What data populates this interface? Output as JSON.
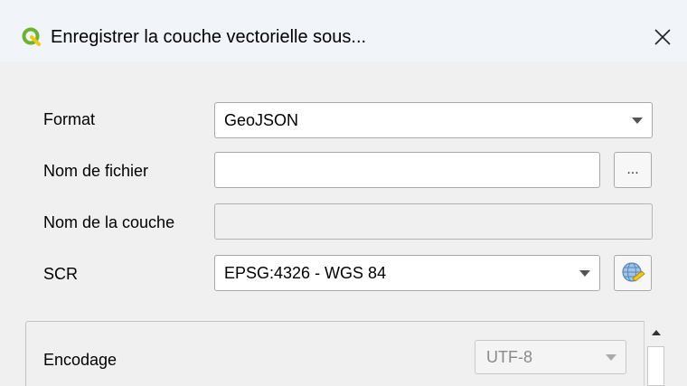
{
  "window": {
    "title": "Enregistrer la couche vectorielle sous...",
    "logo_icon": "qgis-logo-icon",
    "close_icon": "close-icon"
  },
  "form": {
    "format": {
      "label": "Format",
      "value": "GeoJSON"
    },
    "filename": {
      "label": "Nom de fichier",
      "value": "",
      "browse_label": "..."
    },
    "layer_name": {
      "label": "Nom de la couche",
      "value": ""
    },
    "crs": {
      "label": "SCR",
      "value": "EPSG:4326 - WGS 84",
      "selector_icon": "globe-crs-icon"
    }
  },
  "encoding": {
    "label": "Encodage",
    "value": "UTF-8"
  },
  "colors": {
    "titlebar_bg": "#f1f4f9",
    "dialog_bg": "#f0f0f0",
    "qgis_green": "#6bb42c",
    "qgis_yellow": "#f2c811"
  }
}
